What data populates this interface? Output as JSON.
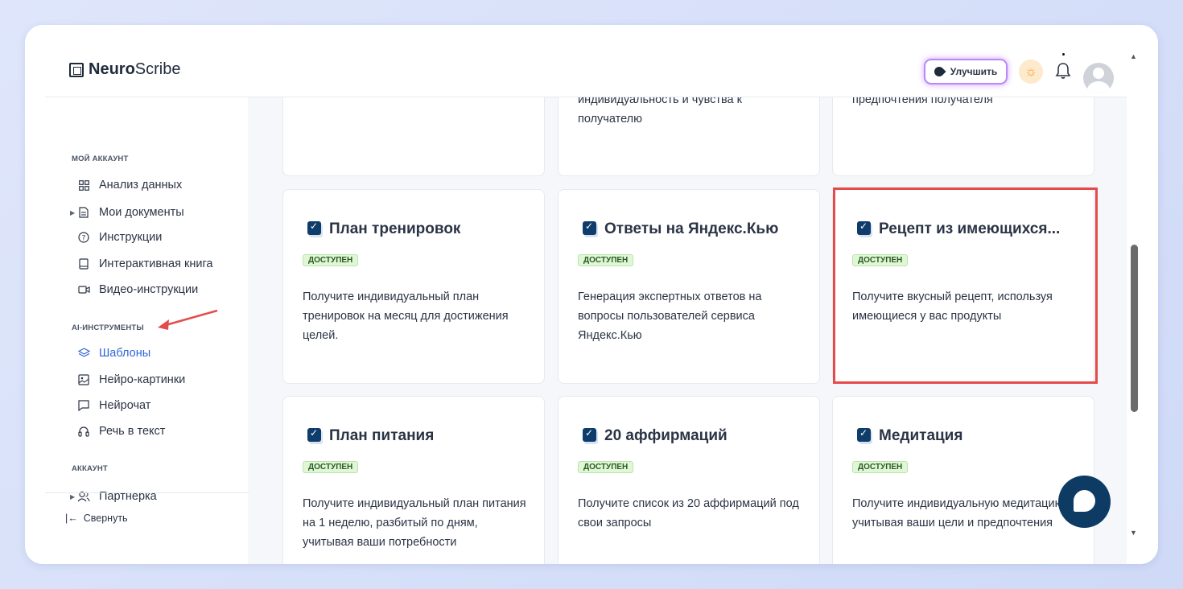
{
  "app": {
    "logo_bold": "Neuro",
    "logo_light": "Scribe",
    "upgrade_label": "Улучшить"
  },
  "sidebar": {
    "sections": [
      {
        "label": "МОЙ АККАУНТ"
      },
      {
        "label": "AI-ИНСТРУМЕНТЫ"
      },
      {
        "label": "АККАУНТ"
      }
    ],
    "items": [
      {
        "label": "Анализ данных",
        "icon": "grid-icon"
      },
      {
        "label": "Мои документы",
        "icon": "document-icon"
      },
      {
        "label": "Инструкции",
        "icon": "help-icon"
      },
      {
        "label": "Интерактивная книга",
        "icon": "book-icon"
      },
      {
        "label": "Видео-инструкции",
        "icon": "video-icon"
      },
      {
        "label": "Шаблоны",
        "icon": "layers-icon",
        "active": true
      },
      {
        "label": "Нейро-картинки",
        "icon": "image-icon"
      },
      {
        "label": "Нейрочат",
        "icon": "chat-icon"
      },
      {
        "label": "Речь в текст",
        "icon": "headphones-icon"
      },
      {
        "label": "Партнерка",
        "icon": "users-icon"
      }
    ],
    "collapse_label": "Свернуть"
  },
  "top_cards": [
    {
      "desc": ""
    },
    {
      "desc": "индивидуальность и чувства к получателю"
    },
    {
      "desc": "предпочтения получателя"
    }
  ],
  "cards": [
    {
      "title": "План тренировок",
      "badge": "ДОСТУПЕН",
      "desc": "Получите индивидуальный план тренировок на месяц для достижения целей."
    },
    {
      "title": "Ответы на Яндекс.Кью",
      "badge": "ДОСТУПЕН",
      "desc": "Генерация экспертных ответов на вопросы пользователей сервиса Яндекс.Кью"
    },
    {
      "title": "Рецепт из имеющихся...",
      "badge": "ДОСТУПЕН",
      "desc": "Получите вкусный рецепт, используя имеющиеся у вас продукты"
    },
    {
      "title": "План питания",
      "badge": "ДОСТУПЕН",
      "desc": "Получите индивидуальный план питания на 1 неделю, разбитый по дням, учитывая ваши потребности"
    },
    {
      "title": "20 аффирмаций",
      "badge": "ДОСТУПЕН",
      "desc": "Получите список из 20 аффирмаций под свои запросы"
    },
    {
      "title": "Медитация",
      "badge": "ДОСТУПЕН",
      "desc": "Получите индивидуальную медитацию, учитывая ваши цели и предпочтения"
    }
  ],
  "colors": {
    "accent": "#2f65d9",
    "highlight": "#e64a4a",
    "badge_bg": "#dff6d7",
    "chat_fab": "#0d3b63"
  }
}
